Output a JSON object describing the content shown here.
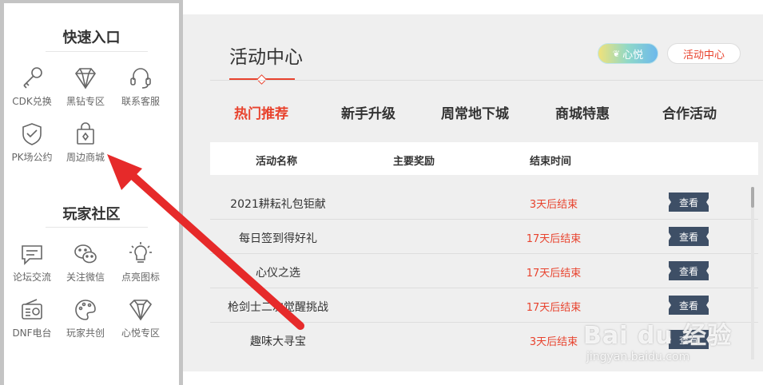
{
  "sidebar": {
    "quick_title": "快速入口",
    "quick_items": [
      {
        "label": "CDK兑换",
        "icon": "key-icon"
      },
      {
        "label": "黑钻专区",
        "icon": "diamond-icon"
      },
      {
        "label": "联系客服",
        "icon": "headset-icon"
      },
      {
        "label": "PK场公约",
        "icon": "shield-check-icon"
      },
      {
        "label": "周边商城",
        "icon": "shopping-bag-icon"
      }
    ],
    "community_title": "玩家社区",
    "community_items": [
      {
        "label": "论坛交流",
        "icon": "forum-icon"
      },
      {
        "label": "关注微信",
        "icon": "wechat-icon"
      },
      {
        "label": "点亮图标",
        "icon": "lightbulb-icon"
      },
      {
        "label": "DNF电台",
        "icon": "radio-icon"
      },
      {
        "label": "玩家共创",
        "icon": "palette-icon"
      },
      {
        "label": "心悦专区",
        "icon": "gem-icon"
      }
    ]
  },
  "main": {
    "title": "活动中心",
    "badge_xinyue": "心悦",
    "badge_center": "活动中心",
    "tabs": [
      {
        "label": "热门推荐",
        "active": true
      },
      {
        "label": "新手升级",
        "active": false
      },
      {
        "label": "周常地下城",
        "active": false
      },
      {
        "label": "商城特惠",
        "active": false
      },
      {
        "label": "合作活动",
        "active": false
      }
    ],
    "table": {
      "headers": [
        "活动名称",
        "主要奖励",
        "结束时间"
      ],
      "view_label": "查看",
      "rows": [
        {
          "name": "2021耕耘礼包钜献",
          "end": "3天后结束"
        },
        {
          "name": "每日签到得好礼",
          "end": "17天后结束"
        },
        {
          "name": "心仪之选",
          "end": "17天后结束"
        },
        {
          "name": "枪剑士二次觉醒挑战",
          "end": "17天后结束"
        },
        {
          "name": "趣味大寻宝",
          "end": "3天后结束"
        }
      ]
    }
  },
  "watermark": {
    "brand": "Bai du 经验",
    "url": "jingyan.baidu.com"
  },
  "colors": {
    "accent": "#e8432e",
    "button": "#3e4f66",
    "arrow": "#e62a2a"
  }
}
